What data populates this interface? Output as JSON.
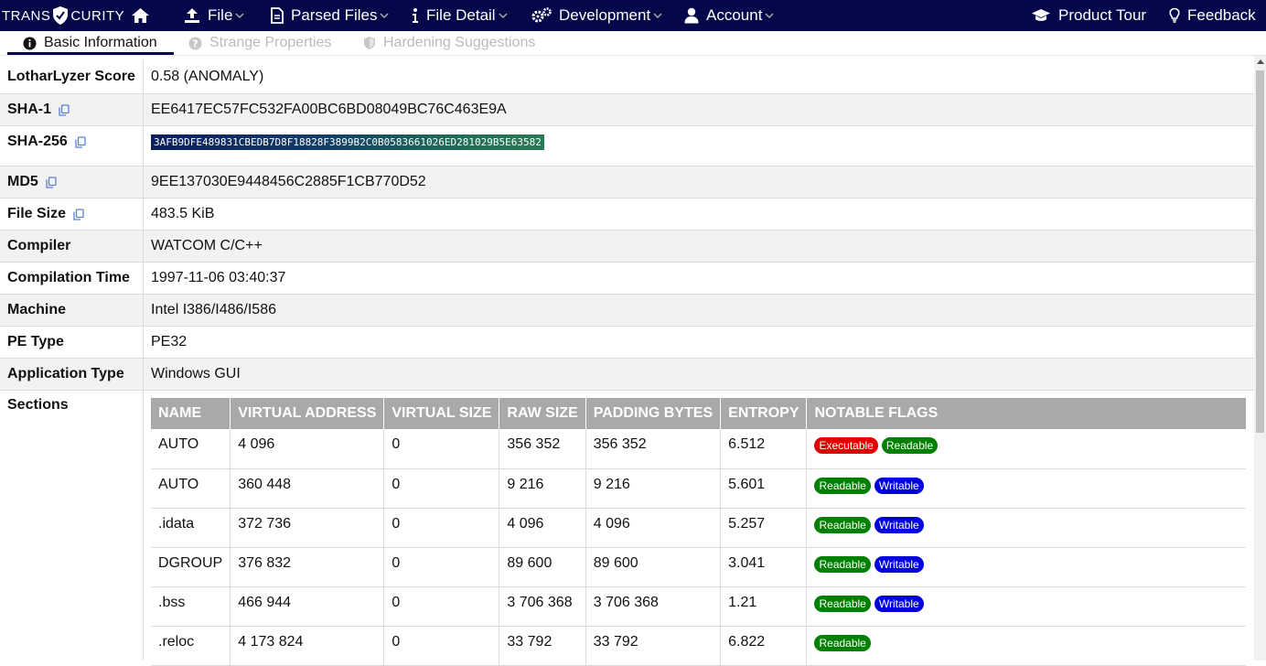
{
  "brand": {
    "left": "TRANS",
    "right": "CURITY"
  },
  "nav": {
    "file": "File",
    "parsed_files": "Parsed Files",
    "file_detail": "File Detail",
    "development": "Development",
    "account": "Account",
    "product_tour": "Product Tour",
    "feedback": "Feedback"
  },
  "tabs": {
    "basic": "Basic Information",
    "strange": "Strange Properties",
    "hardening": "Hardening Suggestions"
  },
  "info": {
    "score_label": "LotharLyzer Score",
    "score_value": "0.58 (ANOMALY)",
    "sha1_label": "SHA-1",
    "sha1_value": "EE6417EC57FC532FA00BC6BD08049BC76C463E9A",
    "sha256_label": "SHA-256",
    "sha256_value": "3AFB9DFE489831CBEDB7D8F18828F3899B2C0B0583661026ED281029B5E63582",
    "md5_label": "MD5",
    "md5_value": "9EE137030E9448456C2885F1CB770D52",
    "size_label": "File Size",
    "size_value": "483.5 KiB",
    "compiler_label": "Compiler",
    "compiler_value": "WATCOM C/C++",
    "comp_time_label": "Compilation Time",
    "comp_time_value": "1997-11-06 03:40:37",
    "machine_label": "Machine",
    "machine_value": "Intel I386/I486/I586",
    "pe_type_label": "PE Type",
    "pe_type_value": "PE32",
    "app_type_label": "Application Type",
    "app_type_value": "Windows GUI",
    "sections_label": "Sections"
  },
  "sections": {
    "headers": [
      "NAME",
      "VIRTUAL ADDRESS",
      "VIRTUAL SIZE",
      "RAW SIZE",
      "PADDING BYTES",
      "ENTROPY",
      "NOTABLE FLAGS"
    ],
    "rows": [
      {
        "name": "AUTO",
        "vaddr": "4 096",
        "vsize": "0",
        "raw": "356 352",
        "pad": "356 352",
        "entropy": "6.512",
        "flags": [
          "Executable",
          "Readable"
        ]
      },
      {
        "name": "AUTO",
        "vaddr": "360 448",
        "vsize": "0",
        "raw": "9 216",
        "pad": "9 216",
        "entropy": "5.601",
        "flags": [
          "Readable",
          "Writable"
        ]
      },
      {
        "name": ".idata",
        "vaddr": "372 736",
        "vsize": "0",
        "raw": "4 096",
        "pad": "4 096",
        "entropy": "5.257",
        "flags": [
          "Readable",
          "Writable"
        ]
      },
      {
        "name": "DGROUP",
        "vaddr": "376 832",
        "vsize": "0",
        "raw": "89 600",
        "pad": "89 600",
        "entropy": "3.041",
        "flags": [
          "Readable",
          "Writable"
        ]
      },
      {
        "name": ".bss",
        "vaddr": "466 944",
        "vsize": "0",
        "raw": "3 706 368",
        "pad": "3 706 368",
        "entropy": "1.21",
        "flags": [
          "Readable",
          "Writable"
        ]
      },
      {
        "name": ".reloc",
        "vaddr": "4 173 824",
        "vsize": "0",
        "raw": "33 792",
        "pad": "33 792",
        "entropy": "6.822",
        "flags": [
          "Readable"
        ]
      }
    ],
    "flag_colors": {
      "Executable": "#e00000",
      "Readable": "#008000",
      "Writable": "#0000dd"
    }
  },
  "colors": {
    "navbar": "#04084a",
    "header_gray": "#a9a9a9"
  }
}
